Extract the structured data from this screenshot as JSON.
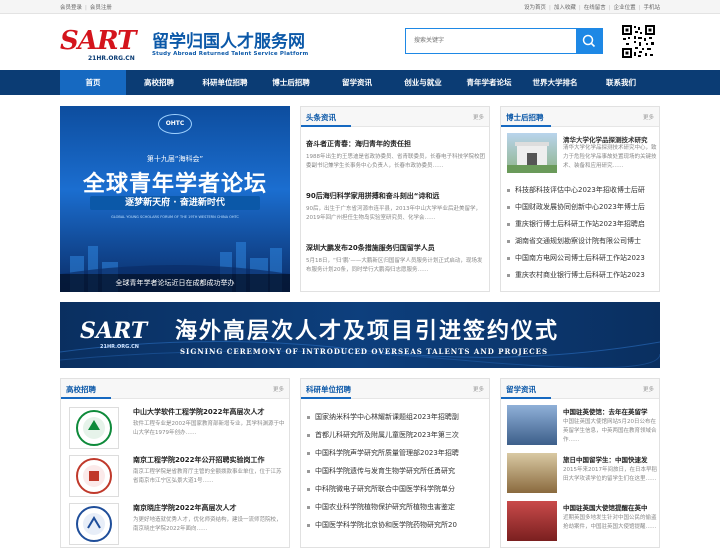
{
  "topbar": {
    "left": [
      "会员登录",
      "会员注册"
    ],
    "right": [
      "设为首页",
      "加入收藏",
      "在线留言",
      "企业位置",
      "手机站"
    ]
  },
  "logo": {
    "mark": "SART",
    "domain": "21HR.ORG.CN",
    "cn": "留学归国人才服务网",
    "en": "Study Abroad Returned Talent Service Platform"
  },
  "search": {
    "placeholder": "搜索关键字"
  },
  "nav": [
    "首页",
    "高校招聘",
    "科研单位招聘",
    "博士后招聘",
    "留学资讯",
    "创业与就业",
    "青年学者论坛",
    "世界大学排名",
    "联系我们"
  ],
  "banner": {
    "badge": "OHTC",
    "edition": "第十九届“海科会”",
    "title": "全球青年学者论坛",
    "slogan": "逐梦新天府 · 奋进新时代",
    "en": "GLOBAL YOUNG SCHOLARS FORUM OF THE 19TH WESTERN CHINA OHTC",
    "caption": "全球青年学者论坛近日在成都成功举办"
  },
  "headlines": {
    "title": "头条资讯",
    "more": "更多",
    "items": [
      {
        "t": "奋斗者正青春：海归青年的责任担",
        "d": "1988年出生的王思迪是省政协委员、省青联委员，长春电子科技学院校团委副书记兼学生长事务中心负责人，长春市政协委员……"
      },
      {
        "t": "90后海归科学家用拼搏和奋斗刻出“诗和远",
        "d": "90后，出生于广东省河源市连平县，2013年中山大学毕业后赴美留学，2019年回广州担任生物岛实验室研究员、化学会……"
      },
      {
        "t": "深圳大鹏发布20条措施服务归国留学人员",
        "d": "5月18日，“归‘鹏’——大鹏新区归国留学人员服务计划正式启动，现场发布服务计划20条，同时举行大鹏海归志愿服务……"
      }
    ]
  },
  "postdoc": {
    "title": "博士后招聘",
    "more": "更多",
    "feature_t": "清华大学化学品探测技术研究",
    "feature_d": "清华大学化学品探测技术研究中心，致力于危险化学品事故处置现场的关键技术、装备和应用研究……",
    "items": [
      "科技部科技评估中心2023年招收博士后研",
      "中国财政发展协同创新中心2023年博士后",
      "重庆银行博士后科研工作站2023年招聘启",
      "湖南省交通规划勘察设计院有限公司博士",
      "中国南方电网公司博士后科研工作站2023",
      "重庆农村商业银行博士后科研工作站2023"
    ]
  },
  "ad": {
    "mark": "SART",
    "domain": "21HR.ORG.CN",
    "cn": "海外高层次人才及项目引进签约仪式",
    "en": "SIGNING CEREMONY OF INTRODUCED OVERSEAS TALENTS AND PROJECES"
  },
  "college": {
    "title": "高校招聘",
    "more": "更多",
    "items": [
      {
        "t": "中山大学软件工程学院2022年高层次人才",
        "d": "软件工程专业是2002年国家教育部新增专业，其学科渊源于中山大学在1979年创办……"
      },
      {
        "t": "南京工程学院2022年公开招聘实验岗工作",
        "d": "南京工程学院是省教育厅主管的全额拨款事业单位，位于江苏省南京市江宁区弘景大道1号……"
      },
      {
        "t": "南京晓庄学院2022年高层次人才",
        "d": "为更好地造就优秀人才，优化师资结构，建设一流师范院校，南京晓庄学院2022年面向……"
      }
    ]
  },
  "research": {
    "title": "科研单位招聘",
    "more": "更多",
    "items": [
      "国家纳米科学中心林耀新课题组2023年招聘副",
      "首都儿科研究所及附属儿童医院2023年第三次",
      "中国科学院声学研究所质量管理部2023年招聘",
      "中国科学院遗传与发育生物学研究所任勇研究",
      "中科院微电子研究所联合中国医学科学院单分",
      "中国农业科学院植物保护研究所植物虫害鉴定",
      "中国医学科学院北京协和医学院药物研究所20"
    ]
  },
  "abroad": {
    "title": "留学资讯",
    "more": "更多",
    "items": [
      {
        "t": "中国驻英使馆：去年在英留学",
        "d": "中国驻英国大使馆网站5月20日公布在英留学生信息，中英两国在教育领域合作……"
      },
      {
        "t": "旅日中国留学生：中国快速发",
        "d": "2015年来2017年间旅日，在日本早稻田大学攻读学位的留学生们在这里……"
      },
      {
        "t": "中国驻英国大使馆提醒在英中",
        "d": "近期英国多地发生针对中国公民的偷盗抢劫案件，中国驻英国大使馆提醒……"
      }
    ]
  }
}
